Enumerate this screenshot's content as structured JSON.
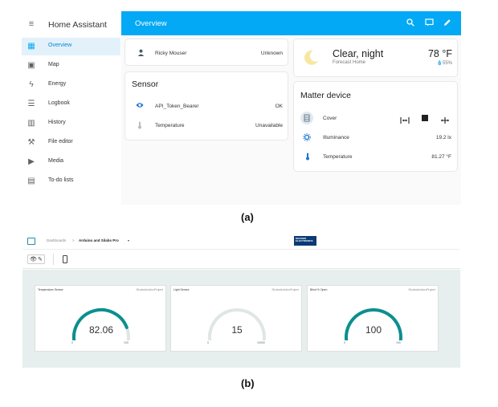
{
  "ha": {
    "app_title": "Home Assistant",
    "nav": [
      {
        "label": "Overview",
        "icon": "dashboard-icon",
        "glyph": "▦",
        "selected": true
      },
      {
        "label": "Map",
        "icon": "map-account-icon",
        "glyph": "▣",
        "selected": false
      },
      {
        "label": "Energy",
        "icon": "lightning-bolt-icon",
        "glyph": "ϟ",
        "selected": false
      },
      {
        "label": "Logbook",
        "icon": "logbook-list-icon",
        "glyph": "☰",
        "selected": false
      },
      {
        "label": "History",
        "icon": "chart-box-icon",
        "glyph": "▥",
        "selected": false
      },
      {
        "label": "File editor",
        "icon": "wrench-icon",
        "glyph": "⚒",
        "selected": false
      },
      {
        "label": "Media",
        "icon": "media-play-icon",
        "glyph": "▶",
        "selected": false
      },
      {
        "label": "To-do lists",
        "icon": "clipboard-list-icon",
        "glyph": "▤",
        "selected": false
      }
    ],
    "topbar_title": "Overview",
    "person": {
      "name": "Ricky Mouser",
      "state": "Unknown"
    },
    "sensor_card": {
      "title": "Sensor",
      "rows": [
        {
          "name": "API_Token_Bearer",
          "value": "OK"
        },
        {
          "name": "Temperature",
          "value": "Unavailable"
        }
      ]
    },
    "weather": {
      "condition": "Clear, night",
      "subtitle": "Forecast Home",
      "temperature": "78 °F",
      "humidity": "55%"
    },
    "matter_card": {
      "title": "Matter device",
      "cover_label": "Cover",
      "rows": [
        {
          "name": "Illuminance",
          "value": "19.2 lx"
        },
        {
          "name": "Temperature",
          "value": "81.27 °F"
        }
      ]
    },
    "caption": "(a)"
  },
  "ard": {
    "breadcrumb_root": "Dashboards",
    "breadcrumb_sep": ">",
    "breadcrumb_current": "Arduino and Silabs Pro",
    "logo_text": "MOUSER ELECTRONICS",
    "widgets": [
      {
        "title": "Temperature Sensor",
        "project": "SiLabsArduinoProject",
        "value": "82.06",
        "min": "0",
        "max": "100",
        "fraction": 0.8206
      },
      {
        "title": "Light Sensor",
        "project": "SiLabsArduinoProject",
        "value": "15",
        "min": "0",
        "max": "10000",
        "fraction": 0.0015
      },
      {
        "title": "Blind % Open",
        "project": "SiLabsArduinoProject",
        "value": "100",
        "min": "0",
        "max": "100",
        "fraction": 1.0
      }
    ],
    "caption": "(b)"
  },
  "colors": {
    "ha_blue": "#03a9f4",
    "gauge_teal": "#0b8f8f",
    "gauge_track": "#dfe6e6"
  }
}
